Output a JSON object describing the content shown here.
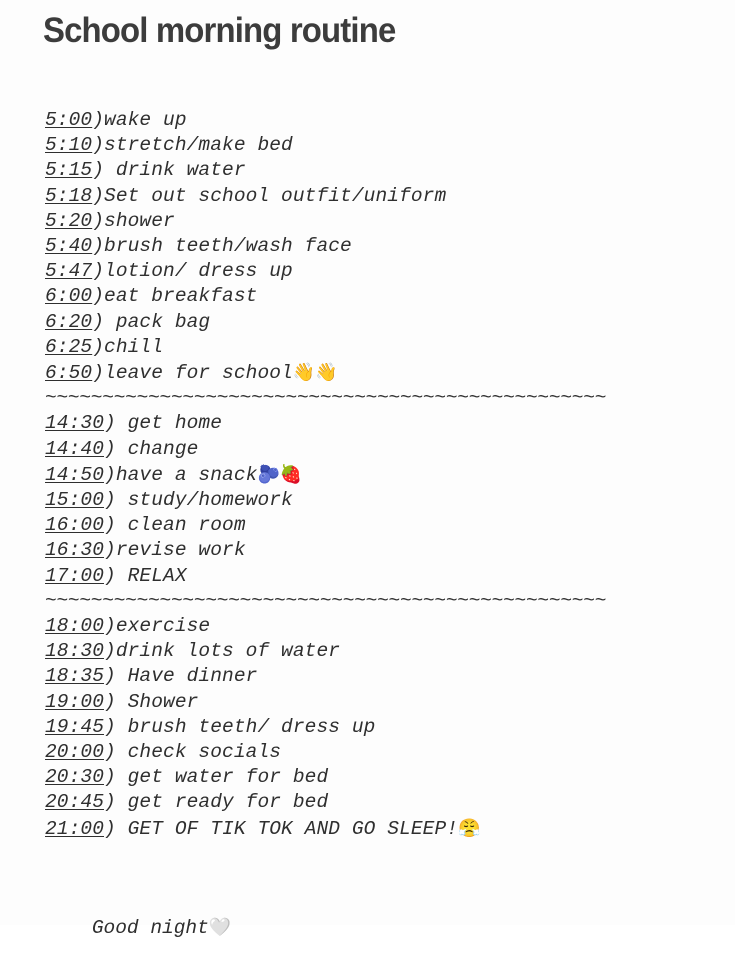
{
  "page": {
    "background_color": "#fdfdfd",
    "text_color": "#2f2f2f",
    "title_color": "#3c3c3c"
  },
  "header": {
    "title": "School morning routine"
  },
  "separator": {
    "text": "~~~~~~~~~~~~~~~~~~~~~~~~~~~~~~~~~~~~~~~~~~~~~~~~~"
  },
  "sections": [
    {
      "id": "morning",
      "items": [
        {
          "time": "5:00",
          "text": ")wake up",
          "emoji": ""
        },
        {
          "time": "5:10",
          "text": ")stretch/make bed",
          "emoji": ""
        },
        {
          "time": "5:15",
          "text": ") drink water",
          "emoji": ""
        },
        {
          "time": "5:18",
          "text": ")Set out school outfit/uniform",
          "emoji": ""
        },
        {
          "time": "5:20",
          "text": ")shower",
          "emoji": ""
        },
        {
          "time": "5:40",
          "text": ")brush teeth/wash face",
          "emoji": ""
        },
        {
          "time": "5:47",
          "text": ")lotion/ dress up",
          "emoji": ""
        },
        {
          "time": "6:00",
          "text": ")eat breakfast",
          "emoji": ""
        },
        {
          "time": "6:20",
          "text": ") pack bag",
          "emoji": ""
        },
        {
          "time": "6:25",
          "text": ")chill",
          "emoji": ""
        },
        {
          "time": "6:50",
          "text": ")leave for school",
          "emoji": "👋👋"
        }
      ]
    },
    {
      "id": "afternoon",
      "items": [
        {
          "time": "14:30",
          "text": ") get home",
          "emoji": ""
        },
        {
          "time": "14:40",
          "text": ") change",
          "emoji": ""
        },
        {
          "time": "14:50",
          "text": ")have a snack",
          "emoji": "🫐🍓"
        },
        {
          "time": "15:00",
          "text": ") study/homework",
          "emoji": ""
        },
        {
          "time": "16:00",
          "text": ") clean room",
          "emoji": ""
        },
        {
          "time": "16:30",
          "text": ")revise work",
          "emoji": ""
        },
        {
          "time": "17:00",
          "text": ") RELAX",
          "emoji": ""
        }
      ]
    },
    {
      "id": "evening",
      "items": [
        {
          "time": "18:00",
          "text": ")exercise",
          "emoji": ""
        },
        {
          "time": "18:30",
          "text": ")drink lots of water",
          "emoji": ""
        },
        {
          "time": "18:35",
          "text": ") Have dinner",
          "emoji": ""
        },
        {
          "time": "19:00",
          "text": ") Shower",
          "emoji": ""
        },
        {
          "time": "19:45",
          "text": ") brush teeth/ dress up",
          "emoji": ""
        },
        {
          "time": "20:00",
          "text": ") check socials",
          "emoji": ""
        },
        {
          "time": "20:30",
          "text": ") get water for bed",
          "emoji": ""
        },
        {
          "time": "20:45",
          "text": ") get ready for bed",
          "emoji": ""
        },
        {
          "time": "21:00",
          "text": ") GET OF TIK TOK AND GO SLEEP!",
          "emoji": "😤"
        }
      ]
    }
  ],
  "footer": {
    "signoff_text": "Good night",
    "signoff_emoji": "🤍"
  }
}
